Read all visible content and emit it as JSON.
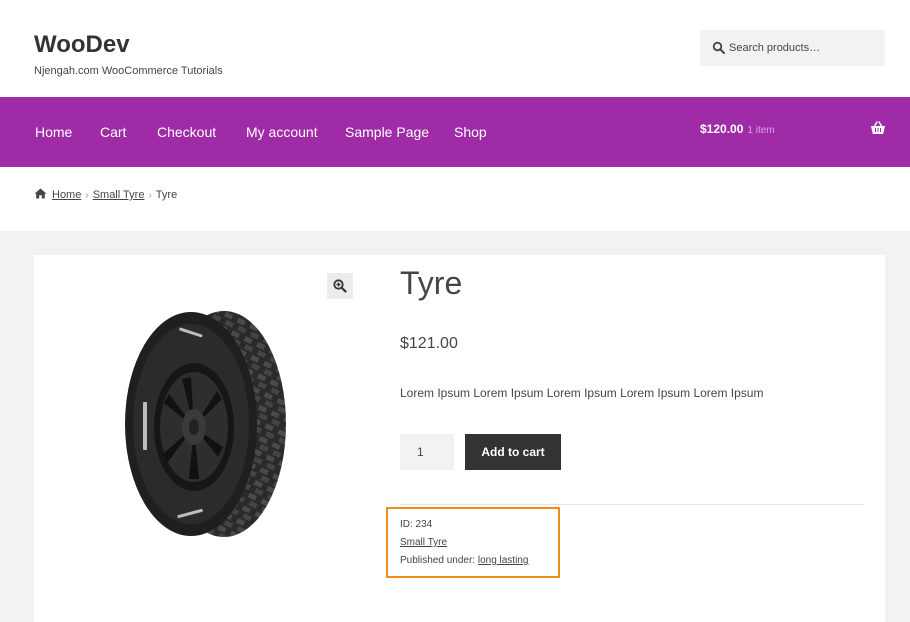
{
  "site": {
    "title": "WooDev",
    "tagline": "Njengah.com WooCommerce Tutorials"
  },
  "search": {
    "placeholder": "Search products…",
    "icon": "search-icon"
  },
  "nav": {
    "items": [
      {
        "label": "Home"
      },
      {
        "label": "Cart"
      },
      {
        "label": "Checkout"
      },
      {
        "label": "My account"
      },
      {
        "label": "Sample Page"
      },
      {
        "label": "Shop"
      }
    ]
  },
  "cart": {
    "total": "$120.00",
    "count": "1 item",
    "icon": "basket-icon"
  },
  "breadcrumb": {
    "home": "Home",
    "category": "Small Tyre",
    "current": "Tyre",
    "separator": "›"
  },
  "product": {
    "title": "Tyre",
    "price": "$121.00",
    "description": "Lorem Ipsum Lorem Ipsum Lorem Ipsum Lorem Ipsum Lorem Ipsum",
    "quantity": "1",
    "add_to_cart_label": "Add to cart",
    "meta": {
      "id_line": "ID: 234",
      "category": "Small Tyre",
      "published_prefix": "Published under:",
      "published_term": "long lasting"
    }
  },
  "colors": {
    "nav_bg": "#a02ba6",
    "button_bg": "#333333",
    "highlight_border": "#f08a1c"
  }
}
